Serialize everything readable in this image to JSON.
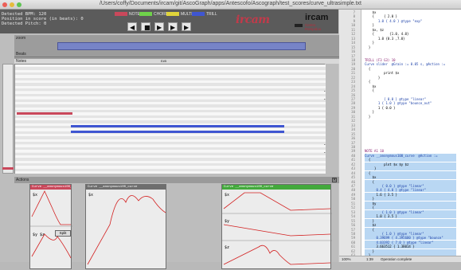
{
  "window": {
    "title": "/Users/coffy/Documents/ircam/git/AscoGraph/apps/Antescofo/Ascograph/test_scores/curve_ultrasimple.txt"
  },
  "info": {
    "bpm": "Detected BPM: 120",
    "position": "Position in score (in beats): 0",
    "pitch": "Detected Pitch: 0"
  },
  "legend": [
    {
      "label": "NOTE",
      "color": "#c9485b"
    },
    {
      "label": "CHORD",
      "color": "#6fd24a"
    },
    {
      "label": "MULTI",
      "color": "#e0d43a"
    },
    {
      "label": "TRILL",
      "color": "#3f56d1"
    }
  ],
  "transport": [
    "play-icon",
    "stop-icon",
    "prev-icon",
    "next-icon",
    "forward-icon"
  ],
  "logo": {
    "script": "ircam",
    "word": "ircam",
    "sub1": "Centre",
    "sub2": "Pompidou"
  },
  "zoom_label": "zoom",
  "beats_label": "Beats",
  "notes_label": "Notes",
  "note_name": "E#5",
  "actions_label": "Actions",
  "panels": [
    {
      "title": "Curve __anonymous100_curve",
      "var1": "$x",
      "var2": "$y $z",
      "btn": "Split"
    },
    {
      "title": "Curve __anonymous100_curve",
      "var1": "$x"
    },
    {
      "title": "Curve __anonymous100_curve",
      "var1": "$x",
      "var2": "$y",
      "var3": "$z"
    }
  ],
  "editor": {
    "lines": [
      {
        "n": "7",
        "t": "    $x"
      },
      {
        "n": "8",
        "t": "    {     { 2.0 }"
      },
      {
        "n": "9",
        "t": "       1.0 { 4.0 } @type \"exp\""
      },
      {
        "n": "10",
        "t": "    }"
      },
      {
        "n": "11",
        "t": "    $x, $z"
      },
      {
        "n": "12",
        "t": "    {        {1.0, 4.0}"
      },
      {
        "n": "13",
        "t": "       1.0 {0.3 ,7.0}"
      },
      {
        "n": "14",
        "t": "    }"
      },
      {
        "n": "15",
        "t": "  }"
      },
      {
        "n": "16",
        "t": ""
      },
      {
        "n": "17",
        "t": ""
      },
      {
        "n": "18",
        "t": "TRILL (F3 G3) 10"
      },
      {
        "n": "19",
        "t": "Curve slider  @Grain := 0.05 s, @Action :="
      },
      {
        "n": "20",
        "t": "  {"
      },
      {
        "n": "21",
        "t": "          print $x"
      },
      {
        "n": "22",
        "t": "       }"
      },
      {
        "n": "23",
        "t": "  {"
      },
      {
        "n": "24",
        "t": "    $x"
      },
      {
        "n": "25",
        "t": "    {"
      },
      {
        "n": "26",
        "t": ""
      },
      {
        "n": "27",
        "t": "          { 0.0 } @type \"linear\""
      },
      {
        "n": "28",
        "t": "       1 { 1.0 } @type \"bounce_out\""
      },
      {
        "n": "29",
        "t": "       1 { 0.0 }"
      },
      {
        "n": "30",
        "t": "    }"
      },
      {
        "n": "31",
        "t": "  }"
      },
      {
        "n": "32",
        "t": ""
      },
      {
        "n": "33",
        "t": ""
      },
      {
        "n": "34",
        "t": ""
      },
      {
        "n": "35",
        "t": ""
      },
      {
        "n": "36",
        "t": ""
      },
      {
        "n": "37",
        "t": ""
      },
      {
        "n": "38",
        "t": ""
      },
      {
        "n": "39",
        "t": "NOTE A1 10"
      },
      {
        "n": "40",
        "t": "Curve __anonymous100_curve  @Action :="
      },
      {
        "n": "41",
        "t": "  {"
      },
      {
        "n": "42",
        "t": "          plot $x $y $z"
      },
      {
        "n": "43",
        "t": "     }"
      },
      {
        "n": "44",
        "t": "  {"
      },
      {
        "n": "45",
        "t": "    $x"
      },
      {
        "n": "46",
        "t": "    {"
      },
      {
        "n": "47",
        "t": "         { 0.0 } @type \"linear\""
      },
      {
        "n": "48",
        "t": "      0.4 { 4.0 } @type \"linear\""
      },
      {
        "n": "49",
        "t": "      1.6 { 3.5 }"
      },
      {
        "n": "50",
        "t": "    }"
      },
      {
        "n": "51",
        "t": "    $y"
      },
      {
        "n": "52",
        "t": "    {"
      },
      {
        "n": "53",
        "t": "         { 1.0 } @type \"linear\""
      },
      {
        "n": "54",
        "t": "      1.0 { 3.5 }"
      },
      {
        "n": "55",
        "t": "    }"
      },
      {
        "n": "56",
        "t": "    $z"
      },
      {
        "n": "57",
        "t": "    {"
      },
      {
        "n": "58",
        "t": "         { 1.0 } @type \"linear\""
      },
      {
        "n": "59",
        "t": "      0.39699 { 4.395600 } @type \"bounce\""
      },
      {
        "n": "60",
        "t": "      4.03392 { 7.0 } @type \"linear\""
      },
      {
        "n": "61",
        "t": "      3.663512 { 1.38014 }"
      },
      {
        "n": "62",
        "t": "    }"
      },
      {
        "n": "63",
        "t": "  }"
      }
    ],
    "status_zoom": "100%",
    "status_pos": "1:39",
    "status_msg": "Operation complete"
  }
}
